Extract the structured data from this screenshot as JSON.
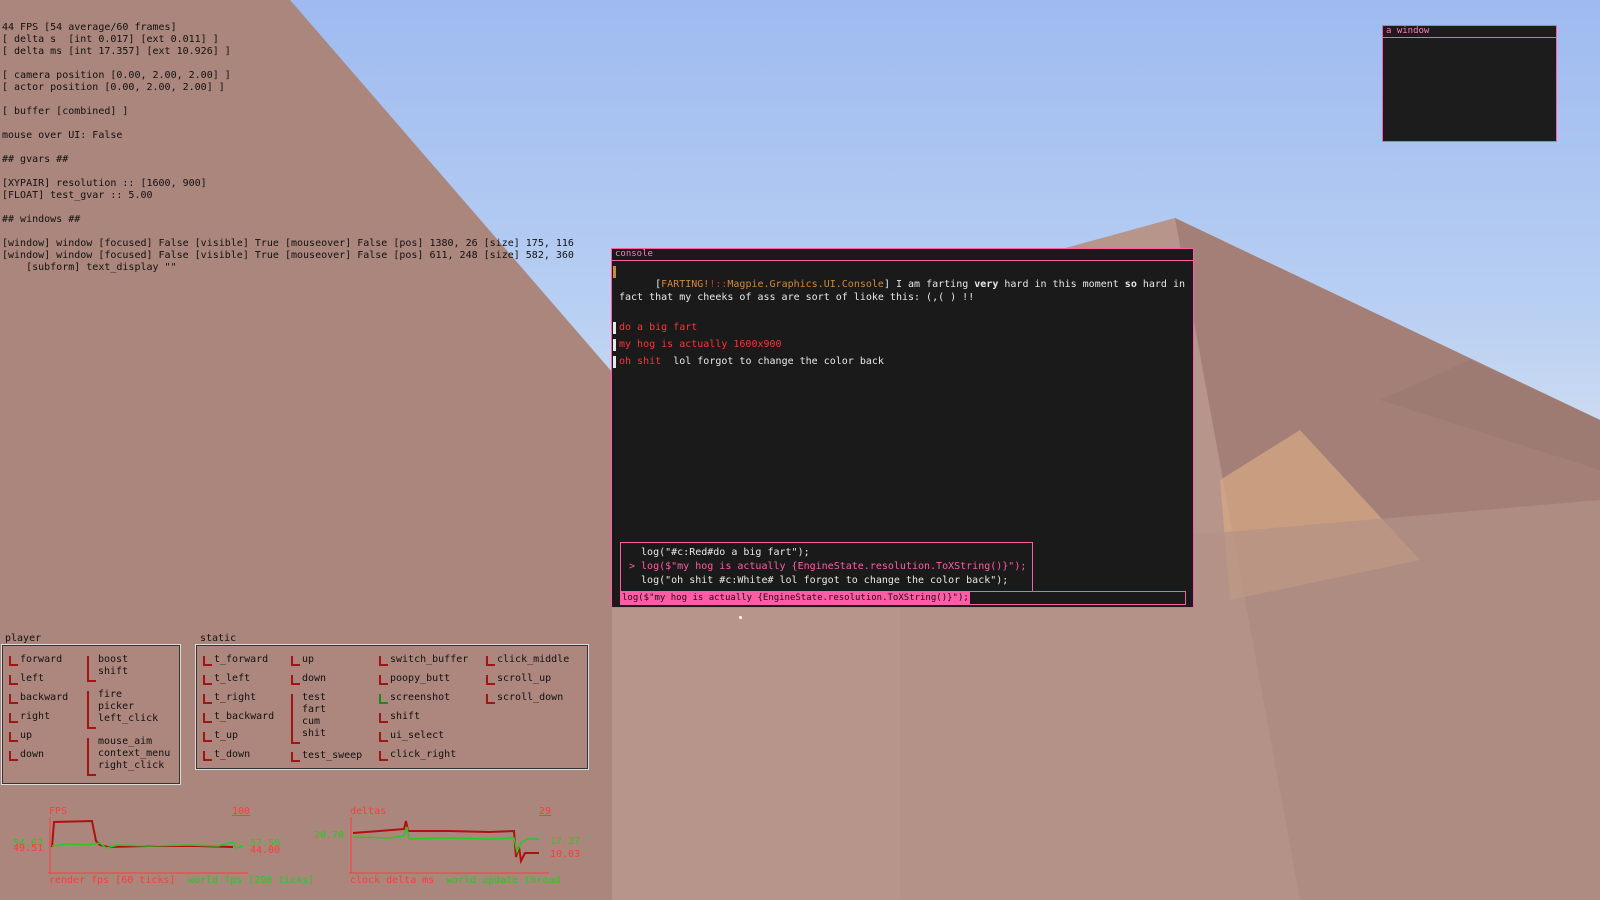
{
  "debug": {
    "lines": [
      "44 FPS [54 average/60 frames]",
      "[ delta s  [int 0.017] [ext 0.011] ]",
      "[ delta ms [int 17.357] [ext 10.926] ]",
      "",
      "[ camera position [0.00, 2.00, 2.00] ]",
      "[ actor position [0.00, 2.00, 2.00] ]",
      "",
      "[ buffer [combined] ]",
      "",
      "mouse over UI: False",
      "",
      "## gvars ##",
      "",
      "[XYPAIR] resolution :: [1600, 900]",
      "[FLOAT] test_gvar :: 5.00",
      "",
      "## windows ##",
      "",
      "[window] window [focused] False [visible] True [mouseover] False [pos] 1380, 26 [size] 175, 116",
      "[window] window [focused] False [visible] True [mouseover] False [pos] 611, 248 [size] 582, 360",
      "    [subform] text_display \"\""
    ]
  },
  "small_window": {
    "title": "a window"
  },
  "console": {
    "title": "console",
    "log": {
      "l1_tag_open": "[",
      "l1_tag_a": "FARTING!",
      "l1_tag_sep": "!::",
      "l1_tag_b": "Magpie.Graphics.UI.Console",
      "l1_tag_close": "]",
      "l1_text_1": " I am farting ",
      "l1_bold_1": "very",
      "l1_text_2": " hard in this moment ",
      "l1_bold_2": "so",
      "l1_text_3": " hard in fact that my cheeks of ass are sort of lioke this: (,( ) !!",
      "l2": "do a big fart",
      "l3": "my hog is actually 1600x900",
      "l4_red": "oh shit",
      "l4_white": "  lol forgot to change the color back"
    },
    "history": [
      "  log(\"#c:Red#do a big fart\");",
      "> log($\"my hog is actually {EngineState.resolution.ToXString()}\");",
      "  log(\"oh shit #c:White# lol forgot to change the color back\");"
    ],
    "input_value": "log($\"my hog is actually {EngineState.resolution.ToXString()}\");"
  },
  "player_panel": {
    "title": "player",
    "keys": [
      "forward",
      "left",
      "backward",
      "right",
      "up",
      "down",
      "boost\nshift",
      "fire\npicker\nleft_click",
      "mouse_aim\ncontext_menu\nright_click"
    ]
  },
  "static_panel": {
    "title": "static",
    "keys": [
      "t_forward",
      "t_left",
      "t_right",
      "t_backward",
      "t_up",
      "t_down",
      "up",
      "down",
      "test\nfart\ncum\nshit",
      "test_sweep",
      "switch_buffer",
      "poopy_butt",
      "screenshot",
      "shift",
      "ui_select",
      "click_right",
      "click_middle",
      "scroll_up",
      "scroll_down"
    ]
  },
  "fps_graph": {
    "title": "FPS",
    "max": "100",
    "left_val_1": "54.63",
    "left_val_2": "49.51",
    "right_val_1": "57.59",
    "right_val_2": "44.00",
    "footer_1": "render fps [60 ticks]",
    "footer_2": "world fps [290 ticks]"
  },
  "delta_graph": {
    "title": "deltas",
    "max": "29",
    "left_val": "20.70",
    "right_val_1": "17.37",
    "right_val_2": "10.03",
    "footer_1": "clock delta ms",
    "footer_2": "world update thread"
  },
  "colors": {
    "accent": "#ff5ca8",
    "red": "#ff3333",
    "green": "#22cc22",
    "panel_bg": "#1a1a1a"
  }
}
